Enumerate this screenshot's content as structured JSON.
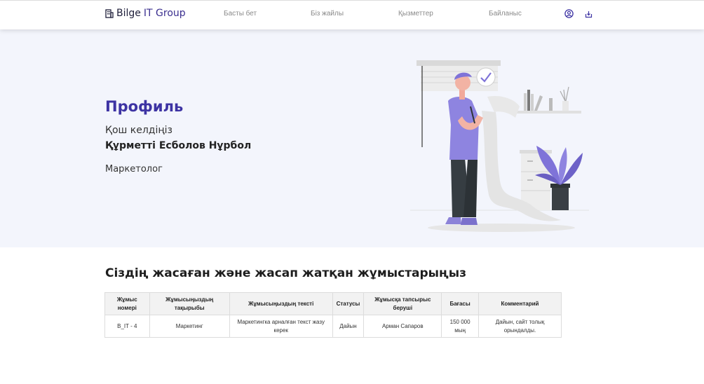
{
  "header": {
    "brand_main": "Bilge",
    "brand_accent": "IT Group",
    "nav": [
      {
        "label": "Басты бет"
      },
      {
        "label": "Біз жайлы"
      },
      {
        "label": "Қызметтер"
      },
      {
        "label": "Байланыс"
      }
    ],
    "icons": [
      "user-circle-icon",
      "logout-icon"
    ]
  },
  "hero": {
    "title": "Профиль",
    "welcome": "Қош келдіңіз",
    "name": "Құрметті Есболов Нұрбол",
    "role": "Маркетолог",
    "accent_color": "#3d33a3"
  },
  "works": {
    "title": "Сіздің жасаған және жасап жатқан жұмыстарыңыз",
    "columns": [
      "Жұмыс номері",
      "Жұмысыңыздың тақырыбы",
      "Жұмысыңыздың тексті",
      "Статусы",
      "Жұмысқа тапсырыс беруші",
      "Бағасы",
      "Комментарий"
    ],
    "rows": [
      [
        "B_IT - 4",
        "Маркетинг",
        "Маркетингка арналған текст жазу керек",
        "Дайын",
        "Арман Сапаров",
        "150 000 мың",
        "Дайын, сайт толық орындалды."
      ]
    ]
  }
}
